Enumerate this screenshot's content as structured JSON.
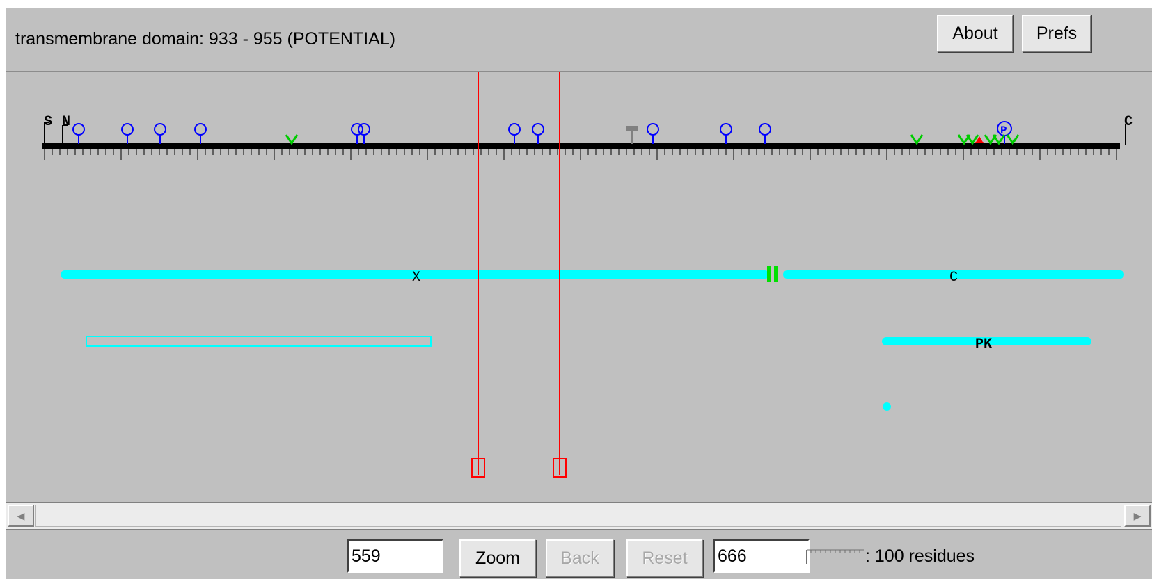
{
  "header": {
    "status_text": "transmembrane domain: 933 - 955 (POTENTIAL)",
    "about_label": "About",
    "prefs_label": "Prefs"
  },
  "sequence_map": {
    "terminal_labels": {
      "start_s": "S",
      "start_n": "N",
      "end_c": "C"
    },
    "selection": {
      "start": 559,
      "end": 666
    },
    "tracks": [
      {
        "segments": [
          {
            "label": "X",
            "style": "filled",
            "color": "#00ffff"
          },
          {
            "label": "C",
            "style": "filled",
            "color": "#00ffff"
          }
        ],
        "junction_marker_color": "#00e000"
      },
      {
        "segments": [
          {
            "label": "",
            "style": "outline",
            "color": "#00ffff"
          },
          {
            "label": "PK",
            "style": "filled",
            "color": "#00ffff"
          }
        ]
      },
      {
        "segments": [
          {
            "label": "",
            "style": "dot",
            "color": "#00ffff"
          }
        ]
      }
    ],
    "colors": {
      "ruler": "#000000",
      "glycosylation_site": "#0000ff",
      "green_marker": "#00cc00",
      "selection_line": "#ff0000",
      "grey_marker": "#808080",
      "red_marker": "#ff0000"
    }
  },
  "controls": {
    "start_value": "559",
    "zoom_label": "Zoom",
    "back_label": "Back",
    "reset_label": "Reset",
    "end_value": "666",
    "scale_text": ": 100 residues"
  }
}
